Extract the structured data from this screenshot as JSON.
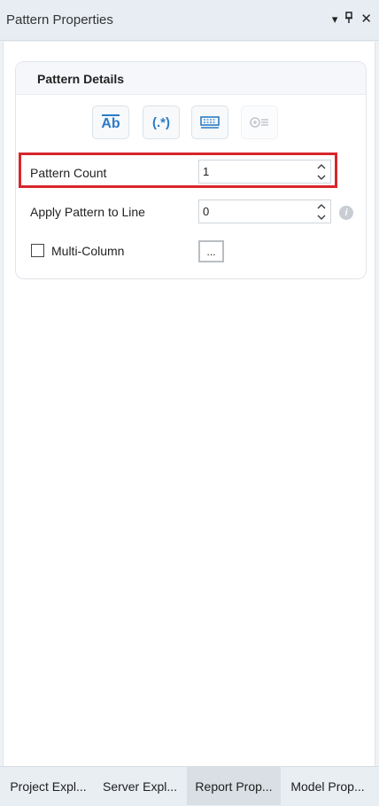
{
  "panel": {
    "title": "Pattern Properties",
    "controls": {
      "dropdown": "▾",
      "pin": "ᛘ",
      "close": "✕"
    }
  },
  "group": {
    "title": "Pattern Details",
    "toolbar": [
      {
        "name": "ab-icon",
        "label": "Ab",
        "enabled": true
      },
      {
        "name": "regex-icon",
        "label": "(.*)",
        "enabled": true
      },
      {
        "name": "keyboard-icon",
        "enabled": true
      },
      {
        "name": "gear-list-icon",
        "enabled": false
      }
    ]
  },
  "fields": {
    "pattern_count": {
      "label": "Pattern Count",
      "value": "1"
    },
    "apply_pattern": {
      "label": "Apply Pattern to Line",
      "value": "0"
    },
    "multi_column": {
      "label": "Multi-Column",
      "checked": false,
      "button": "..."
    }
  },
  "bottom_tabs": [
    {
      "label": "Project Expl...",
      "active": false
    },
    {
      "label": "Server Expl...",
      "active": false
    },
    {
      "label": "Report Prop...",
      "active": true
    },
    {
      "label": "Model Prop...",
      "active": false
    }
  ],
  "colors": {
    "accent": "#2d7bc6",
    "highlight": "#d8262b"
  }
}
